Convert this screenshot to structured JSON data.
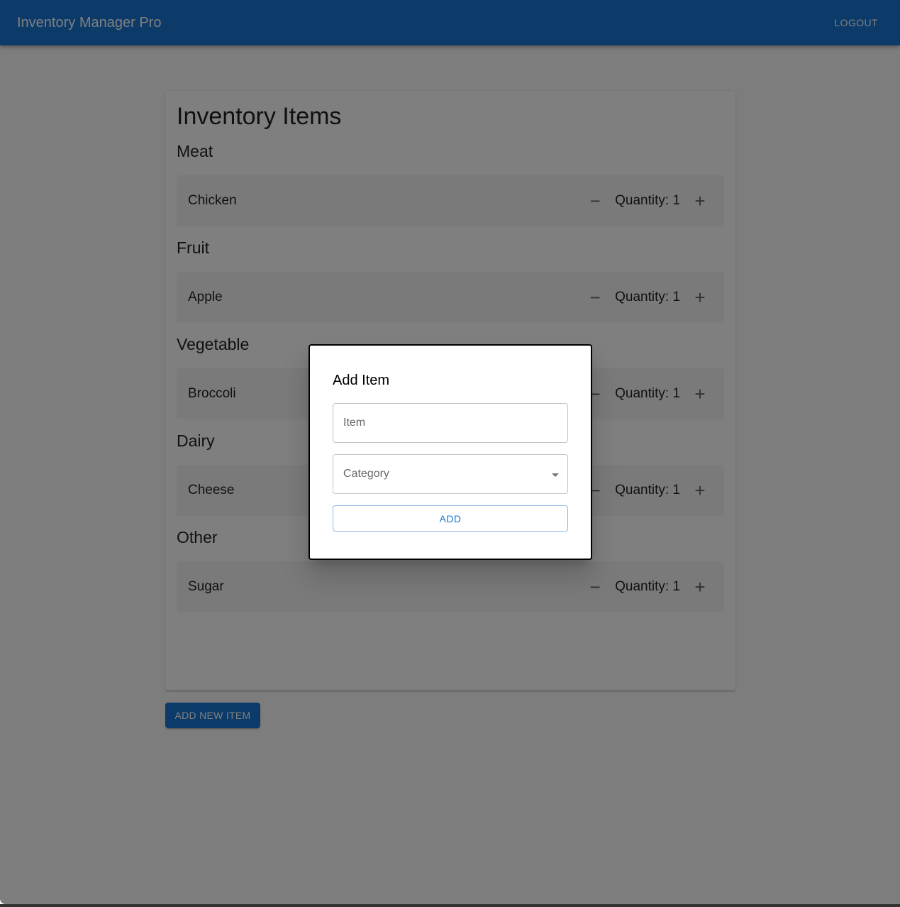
{
  "appbar": {
    "title": "Inventory Manager Pro",
    "logout_label": "LOGOUT"
  },
  "inventory": {
    "title": "Inventory Items",
    "categories": [
      {
        "name": "Meat",
        "items": [
          {
            "name": "Chicken",
            "quantity_label": "Quantity: 1",
            "quantity": 1
          }
        ]
      },
      {
        "name": "Fruit",
        "items": [
          {
            "name": "Apple",
            "quantity_label": "Quantity: 1",
            "quantity": 1
          }
        ]
      },
      {
        "name": "Vegetable",
        "items": [
          {
            "name": "Broccoli",
            "quantity_label": "Quantity: 1",
            "quantity": 1
          }
        ]
      },
      {
        "name": "Dairy",
        "items": [
          {
            "name": "Cheese",
            "quantity_label": "Quantity: 1",
            "quantity": 1
          }
        ]
      },
      {
        "name": "Other",
        "items": [
          {
            "name": "Sugar",
            "quantity_label": "Quantity: 1",
            "quantity": 1
          }
        ]
      }
    ],
    "decrement_symbol": "−",
    "increment_symbol": "+",
    "add_new_label": "ADD NEW ITEM"
  },
  "modal": {
    "title": "Add Item",
    "item_field": {
      "placeholder": "Item",
      "value": ""
    },
    "category_field": {
      "placeholder": "Category",
      "value": ""
    },
    "add_label": "ADD"
  },
  "colors": {
    "primary": "#1976d2",
    "backdrop": "rgba(0,0,0,0.5)"
  }
}
